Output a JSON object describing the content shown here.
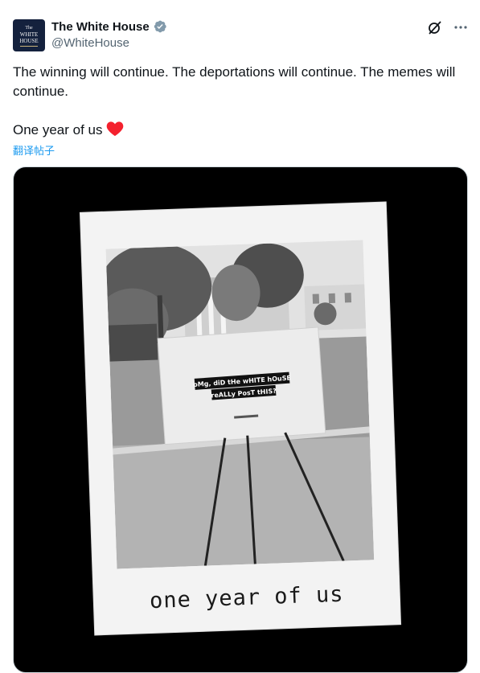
{
  "account": {
    "display_name": "The White House",
    "handle": "@WhiteHouse",
    "avatar_lines": [
      "The",
      "WHITE",
      "HOUSE"
    ]
  },
  "tweet": {
    "line1": "The winning will continue. The deportations will continue. The memes will continue.",
    "line2": "One year of us",
    "translate_label": "翻译帖子"
  },
  "media": {
    "sign_line1": "oMg, diD tHe wHITE hOuSE",
    "sign_line2": "reALLy PosT tHIS?",
    "caption": "one year of us"
  },
  "icons": {
    "verified": "verified-badge-icon",
    "grok": "grok-icon",
    "more": "more-icon",
    "heart": "heart-icon"
  },
  "colors": {
    "accent": "#1d9bf0",
    "heart": "#f4212e",
    "media_bg": "#000000"
  }
}
